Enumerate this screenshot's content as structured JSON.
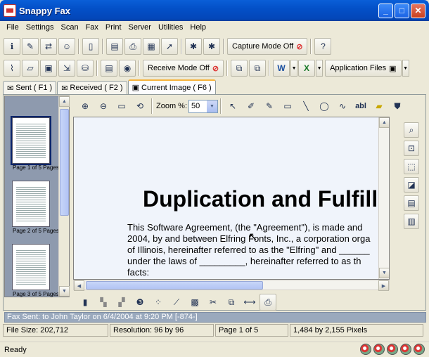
{
  "window": {
    "title": "Snappy Fax",
    "buttons": {
      "min": "_",
      "max": "□",
      "close": "✕"
    }
  },
  "menu": [
    "File",
    "Settings",
    "Scan",
    "Fax",
    "Print",
    "Server",
    "Utilities",
    "Help"
  ],
  "toolbar1": {
    "capture_label": "Capture Mode Off"
  },
  "toolbar2": {
    "receive_label": "Receive Mode Off",
    "appfiles_label": "Application Files"
  },
  "tabs": [
    {
      "label": "Sent ( F1 )"
    },
    {
      "label": "Received ( F2 )"
    },
    {
      "label": "Current Image ( F6 )",
      "active": true
    }
  ],
  "thumbnails": [
    {
      "label": "Page 1 of 5 Pages",
      "selected": true
    },
    {
      "label": "Page 2 of 5 Pages"
    },
    {
      "label": "Page 3 of 5 Pages"
    }
  ],
  "image_toolbar": {
    "zoom_label": "Zoom %:",
    "zoom_value": "50",
    "text_tool": "abl"
  },
  "document": {
    "title": "Duplication and Fulfill",
    "body": "This Software Agreement, (the \"Agreement\"), is made and\n2004, by and between Elfring Fonts, Inc., a corporation orga\nof Illinois, hereinafter referred to as the \"Elfring\" and ______\nunder the laws of _________, hereinafter referred to as th\nfacts:"
  },
  "info_strip": "Fax Sent: to John Taylor on 6/4/2004 at 9:20 PM [-874-]",
  "status_panes": [
    "File Size: 202,712",
    "Resolution: 96 by 96",
    "Page 1 of 5",
    "1,484 by 2,155 Pixels"
  ],
  "status": "Ready",
  "colors": {
    "titlebar": "#0350c8",
    "face": "#ece9d8",
    "panel": "#8e9aae",
    "doc_bg": "#f0f4fb",
    "tab_highlight": "#f7b33d"
  }
}
